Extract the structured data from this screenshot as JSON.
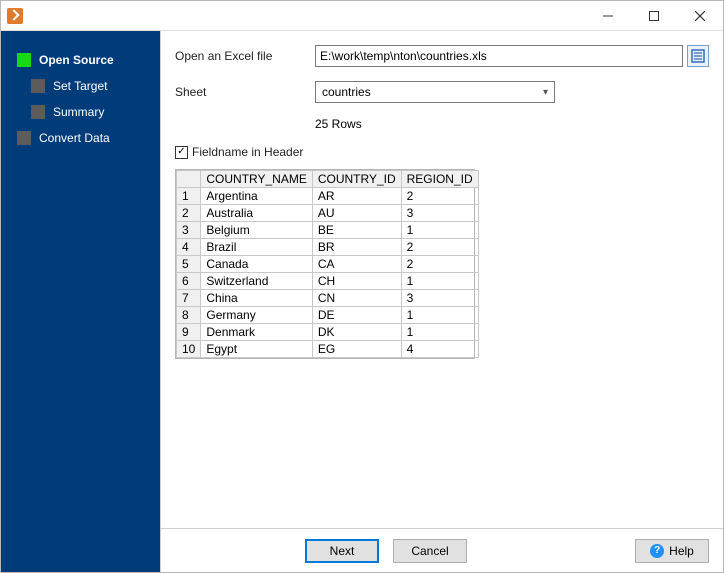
{
  "sidebar": {
    "items": [
      {
        "label": "Open Source"
      },
      {
        "label": "Set Target"
      },
      {
        "label": "Summary"
      },
      {
        "label": "Convert Data"
      }
    ]
  },
  "form": {
    "open_label": "Open an Excel file",
    "file_path": "E:\\work\\temp\\nton\\countries.xls",
    "sheet_label": "Sheet",
    "sheet_value": "countries",
    "rows_label": "25 Rows",
    "chk_label": "Fieldname in Header",
    "chk_checked": true
  },
  "table": {
    "columns": [
      "COUNTRY_NAME",
      "COUNTRY_ID",
      "REGION_ID"
    ],
    "rows": [
      {
        "n": "1",
        "data": [
          "Argentina",
          "AR",
          "2"
        ]
      },
      {
        "n": "2",
        "data": [
          "Australia",
          "AU",
          "3"
        ]
      },
      {
        "n": "3",
        "data": [
          "Belgium",
          "BE",
          "1"
        ]
      },
      {
        "n": "4",
        "data": [
          "Brazil",
          "BR",
          "2"
        ]
      },
      {
        "n": "5",
        "data": [
          "Canada",
          "CA",
          "2"
        ]
      },
      {
        "n": "6",
        "data": [
          "Switzerland",
          "CH",
          "1"
        ]
      },
      {
        "n": "7",
        "data": [
          "China",
          "CN",
          "3"
        ]
      },
      {
        "n": "8",
        "data": [
          "Germany",
          "DE",
          "1"
        ]
      },
      {
        "n": "9",
        "data": [
          "Denmark",
          "DK",
          "1"
        ]
      },
      {
        "n": "10",
        "data": [
          "Egypt",
          "EG",
          "4"
        ]
      }
    ]
  },
  "buttons": {
    "next": "Next",
    "cancel": "Cancel",
    "help": "Help"
  }
}
